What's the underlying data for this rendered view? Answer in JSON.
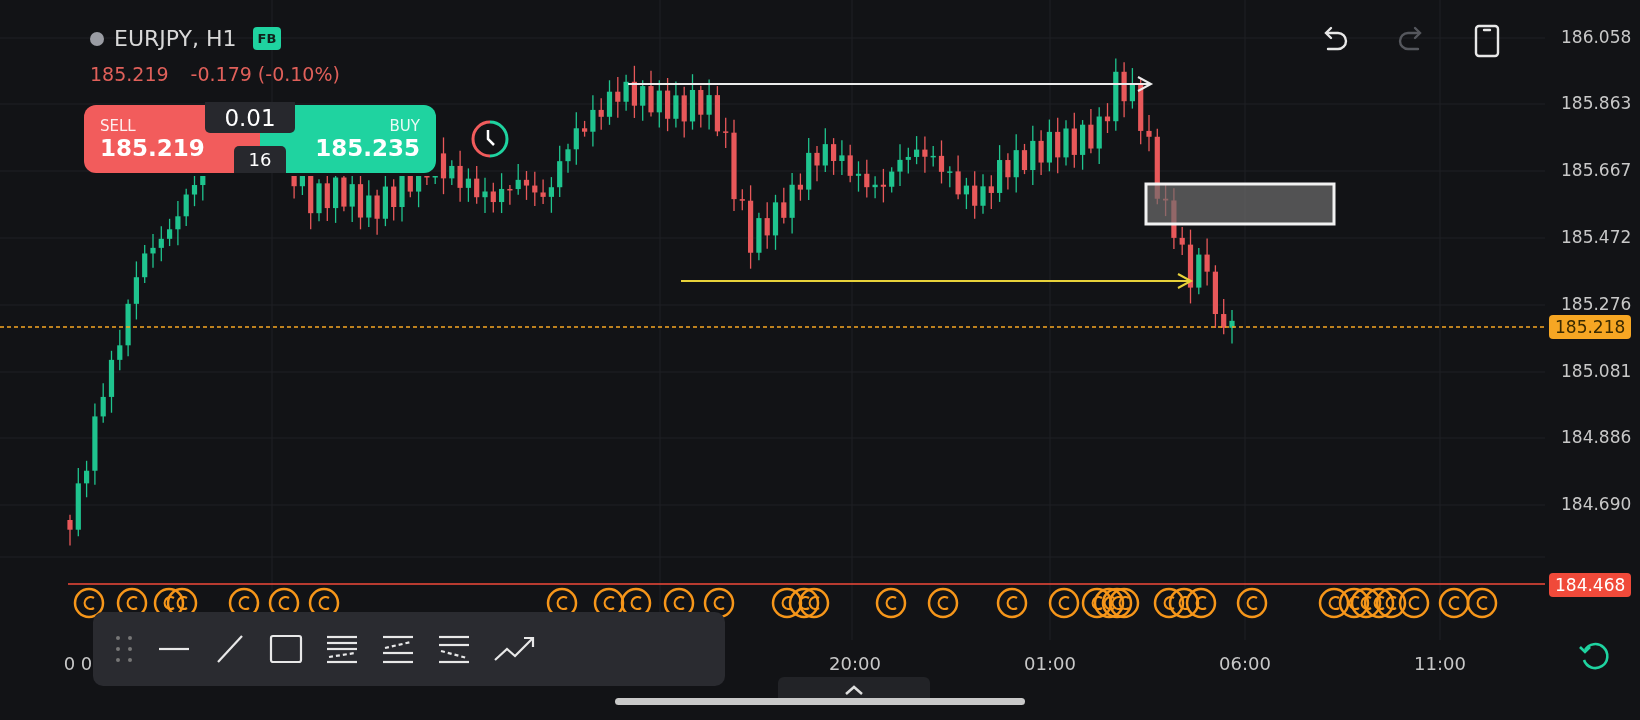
{
  "symbol": {
    "name": "EURJPY, H1",
    "badge": "FB",
    "price": "185.219",
    "change": "-0.179 (-0.10%)"
  },
  "trade": {
    "sell_label": "SELL",
    "sell_price": "185.219",
    "buy_label": "BUY",
    "buy_price": "185.235",
    "lot": "0.01",
    "spread": "16"
  },
  "top_actions": [
    {
      "kind": "undo",
      "disabled": false
    },
    {
      "kind": "redo",
      "disabled": true
    },
    {
      "kind": "device",
      "disabled": false
    }
  ],
  "price_axis": {
    "ticks": [
      "186.058",
      "185.863",
      "185.667",
      "185.472",
      "185.276",
      "185.081",
      "184.886",
      "184.690"
    ],
    "current_price": "185.218",
    "low_marker": "184.468"
  },
  "time_axis": {
    "ticks": [
      "0 0",
      "20:00",
      "01:00",
      "06:00",
      "11:00"
    ]
  },
  "toolbar": {
    "tools": [
      {
        "kind": "handle"
      },
      {
        "kind": "hline"
      },
      {
        "kind": "trendline"
      },
      {
        "kind": "rectangle"
      },
      {
        "kind": "channel"
      },
      {
        "kind": "channel-up"
      },
      {
        "kind": "channel-down"
      },
      {
        "kind": "polyline"
      }
    ]
  }
}
